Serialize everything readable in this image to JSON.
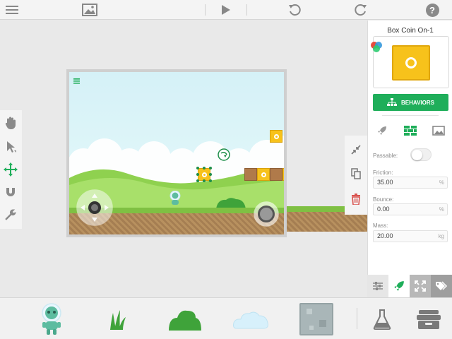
{
  "toolbar": {
    "menu_icon": "hamburger-icon",
    "image_icon": "image-icon",
    "play_icon": "play-icon",
    "undo_icon": "undo-icon",
    "redo_icon": "redo-icon",
    "help_label": "?"
  },
  "panel": {
    "title": "Box Coin On-1",
    "behaviors_label": "BEHAVIORS",
    "passable_label": "Passable:",
    "passable_value": false,
    "friction_label": "Friction:",
    "friction_value": "35.00",
    "friction_unit": "%",
    "bounce_label": "Bounce:",
    "bounce_value": "0.00",
    "bounce_unit": "%",
    "mass_label": "Mass:",
    "mass_value": "20.00",
    "mass_unit": "kg"
  },
  "colors": {
    "accent_green": "#1fae5a",
    "coin_box": "#f7c21b",
    "brick": "#b07a4a",
    "grass": "#7fc043",
    "delete_red": "#d9534f"
  }
}
